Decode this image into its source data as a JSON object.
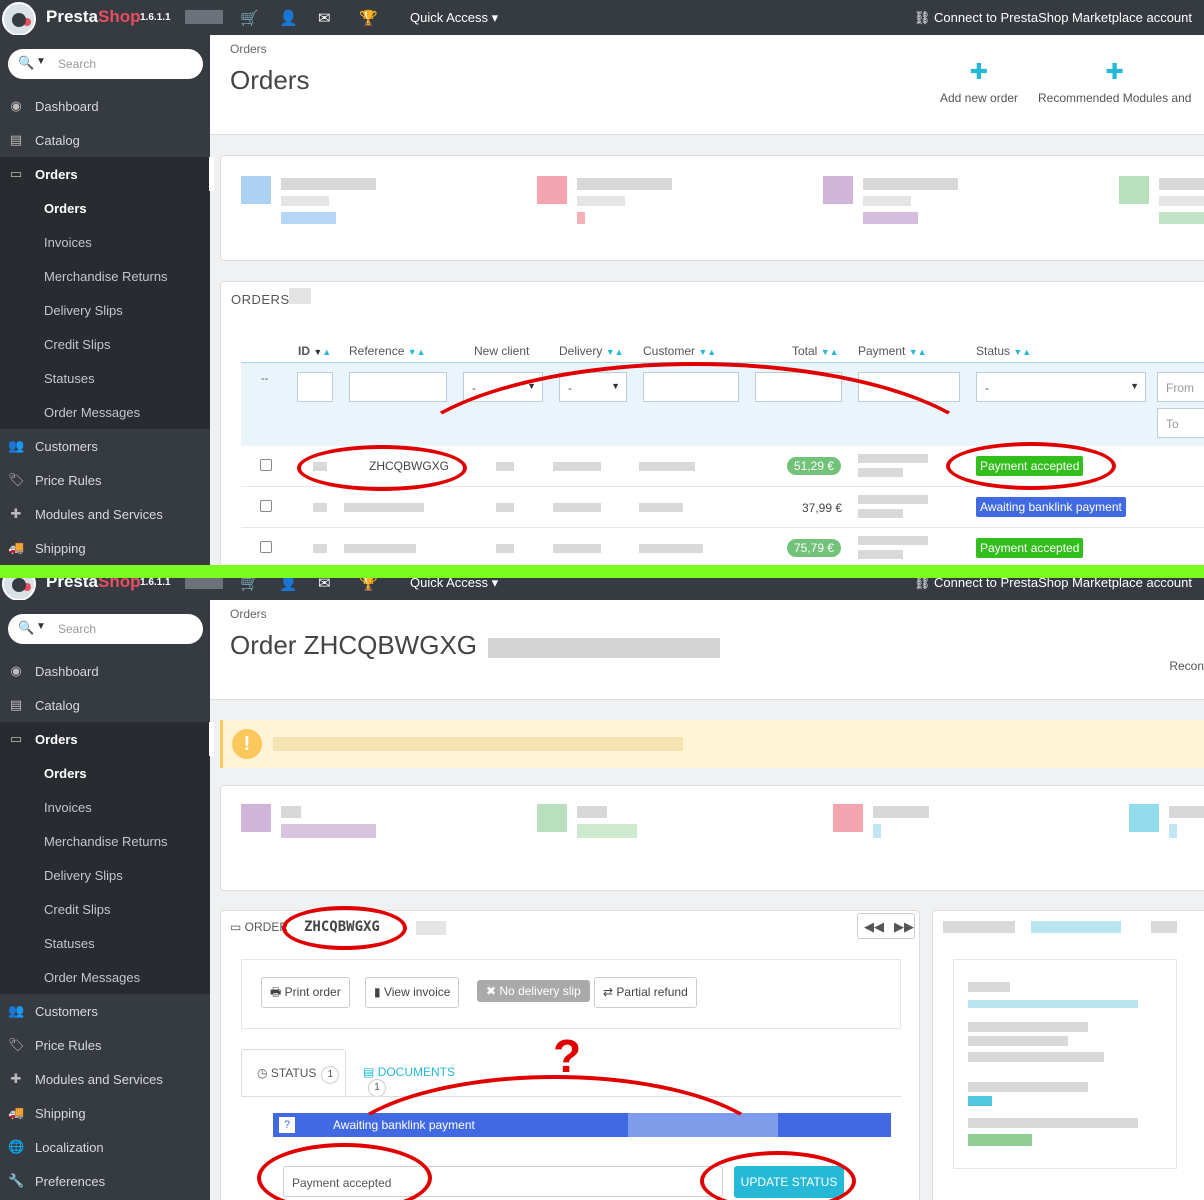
{
  "topbar": {
    "brand_a": "Presta",
    "brand_b": "Shop",
    "version": "1.6.1.1",
    "quick_access": "Quick Access ▾",
    "connect": "Connect to PrestaShop Marketplace account"
  },
  "search": {
    "placeholder": "Search"
  },
  "nav": {
    "dashboard": "Dashboard",
    "catalog": "Catalog",
    "orders": "Orders",
    "customers": "Customers",
    "price_rules": "Price Rules",
    "modules": "Modules and Services",
    "shipping": "Shipping",
    "localization": "Localization",
    "preferences": "Preferences"
  },
  "submenu": [
    "Orders",
    "Invoices",
    "Merchandise Returns",
    "Delivery Slips",
    "Credit Slips",
    "Statuses",
    "Order Messages"
  ],
  "orders_page": {
    "breadcrumb": "Orders",
    "title": "Orders",
    "add_new_order": "Add new order",
    "recommended": "Recommended Modules and",
    "list_heading": "ORDERS",
    "columns": {
      "id": "ID",
      "reference": "Reference",
      "new_client": "New client",
      "delivery": "Delivery",
      "customer": "Customer",
      "total": "Total",
      "payment": "Payment",
      "status": "Status"
    },
    "filter": {
      "dash": "--",
      "select_dash": "-",
      "from": "From",
      "to": "To"
    },
    "rows": [
      {
        "reference": "ZHCQBWGXG",
        "total": "51,29 €",
        "status": "Payment accepted",
        "status_color": "#32be1b"
      },
      {
        "reference": "",
        "total": "37,99 €",
        "status": "Awaiting banklink payment",
        "status_color": "#4169e1"
      },
      {
        "reference": "",
        "total": "75,79 €",
        "status": "Payment accepted",
        "status_color": "#32be1b"
      }
    ]
  },
  "order_page": {
    "breadcrumb": "Orders",
    "title": "Order ZHCQBWGXG",
    "recom": "Recon",
    "order_label": "ORDER",
    "order_ref": "ZHCQBWGXG",
    "buttons": {
      "print": "Print order",
      "invoice": "View invoice",
      "no_slip": "No delivery slip",
      "refund": "Partial refund"
    },
    "tabs": {
      "status": "STATUS",
      "status_count": "1",
      "documents": "DOCUMENTS",
      "documents_count": "1"
    },
    "current_status": "Awaiting banklink payment",
    "status_select": "Payment accepted",
    "update_button": "UPDATE STATUS",
    "annotation": "?"
  }
}
